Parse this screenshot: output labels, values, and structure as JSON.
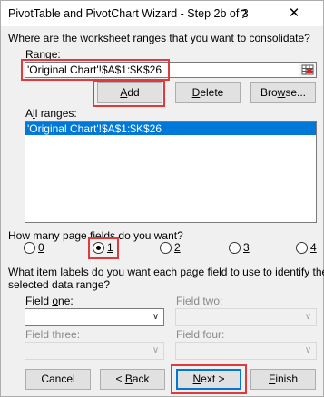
{
  "window": {
    "title": "PivotTable and PivotChart Wizard - Step 2b of 3",
    "help_glyph": "?",
    "close_glyph": "✕"
  },
  "consolidate_question": "Where are the worksheet ranges that you want to consolidate?",
  "range": {
    "label": "Range:",
    "value": "'Original Chart'!$A$1:$K$26",
    "collapse_icon": "range-selector-icon"
  },
  "buttons": {
    "add": "Add",
    "delete": "Delete",
    "browse": "Browse...",
    "cancel": "Cancel",
    "back": "< Back",
    "next": "Next >",
    "finish": "Finish"
  },
  "all_ranges": {
    "label": "All ranges:",
    "items": [
      "'Original Chart'!$A$1:$K$26"
    ],
    "selected_index": 0
  },
  "page_fields": {
    "question": "How many page fields do you want?",
    "options": [
      "0",
      "1",
      "2",
      "3",
      "4"
    ],
    "selected": "1"
  },
  "item_labels_question_line1": "What item labels do you want each page field to use to identify the",
  "item_labels_question_line2": "selected data range?",
  "fields": {
    "one": {
      "label": "Field one:",
      "value": "",
      "enabled": true
    },
    "two": {
      "label": "Field two:",
      "value": "",
      "enabled": false
    },
    "three": {
      "label": "Field three:",
      "value": "",
      "enabled": false
    },
    "four": {
      "label": "Field four:",
      "value": "",
      "enabled": false
    }
  },
  "colors": {
    "highlight": "#e0393e",
    "selection": "#0078d7",
    "button_face": "#e1e1e1"
  }
}
